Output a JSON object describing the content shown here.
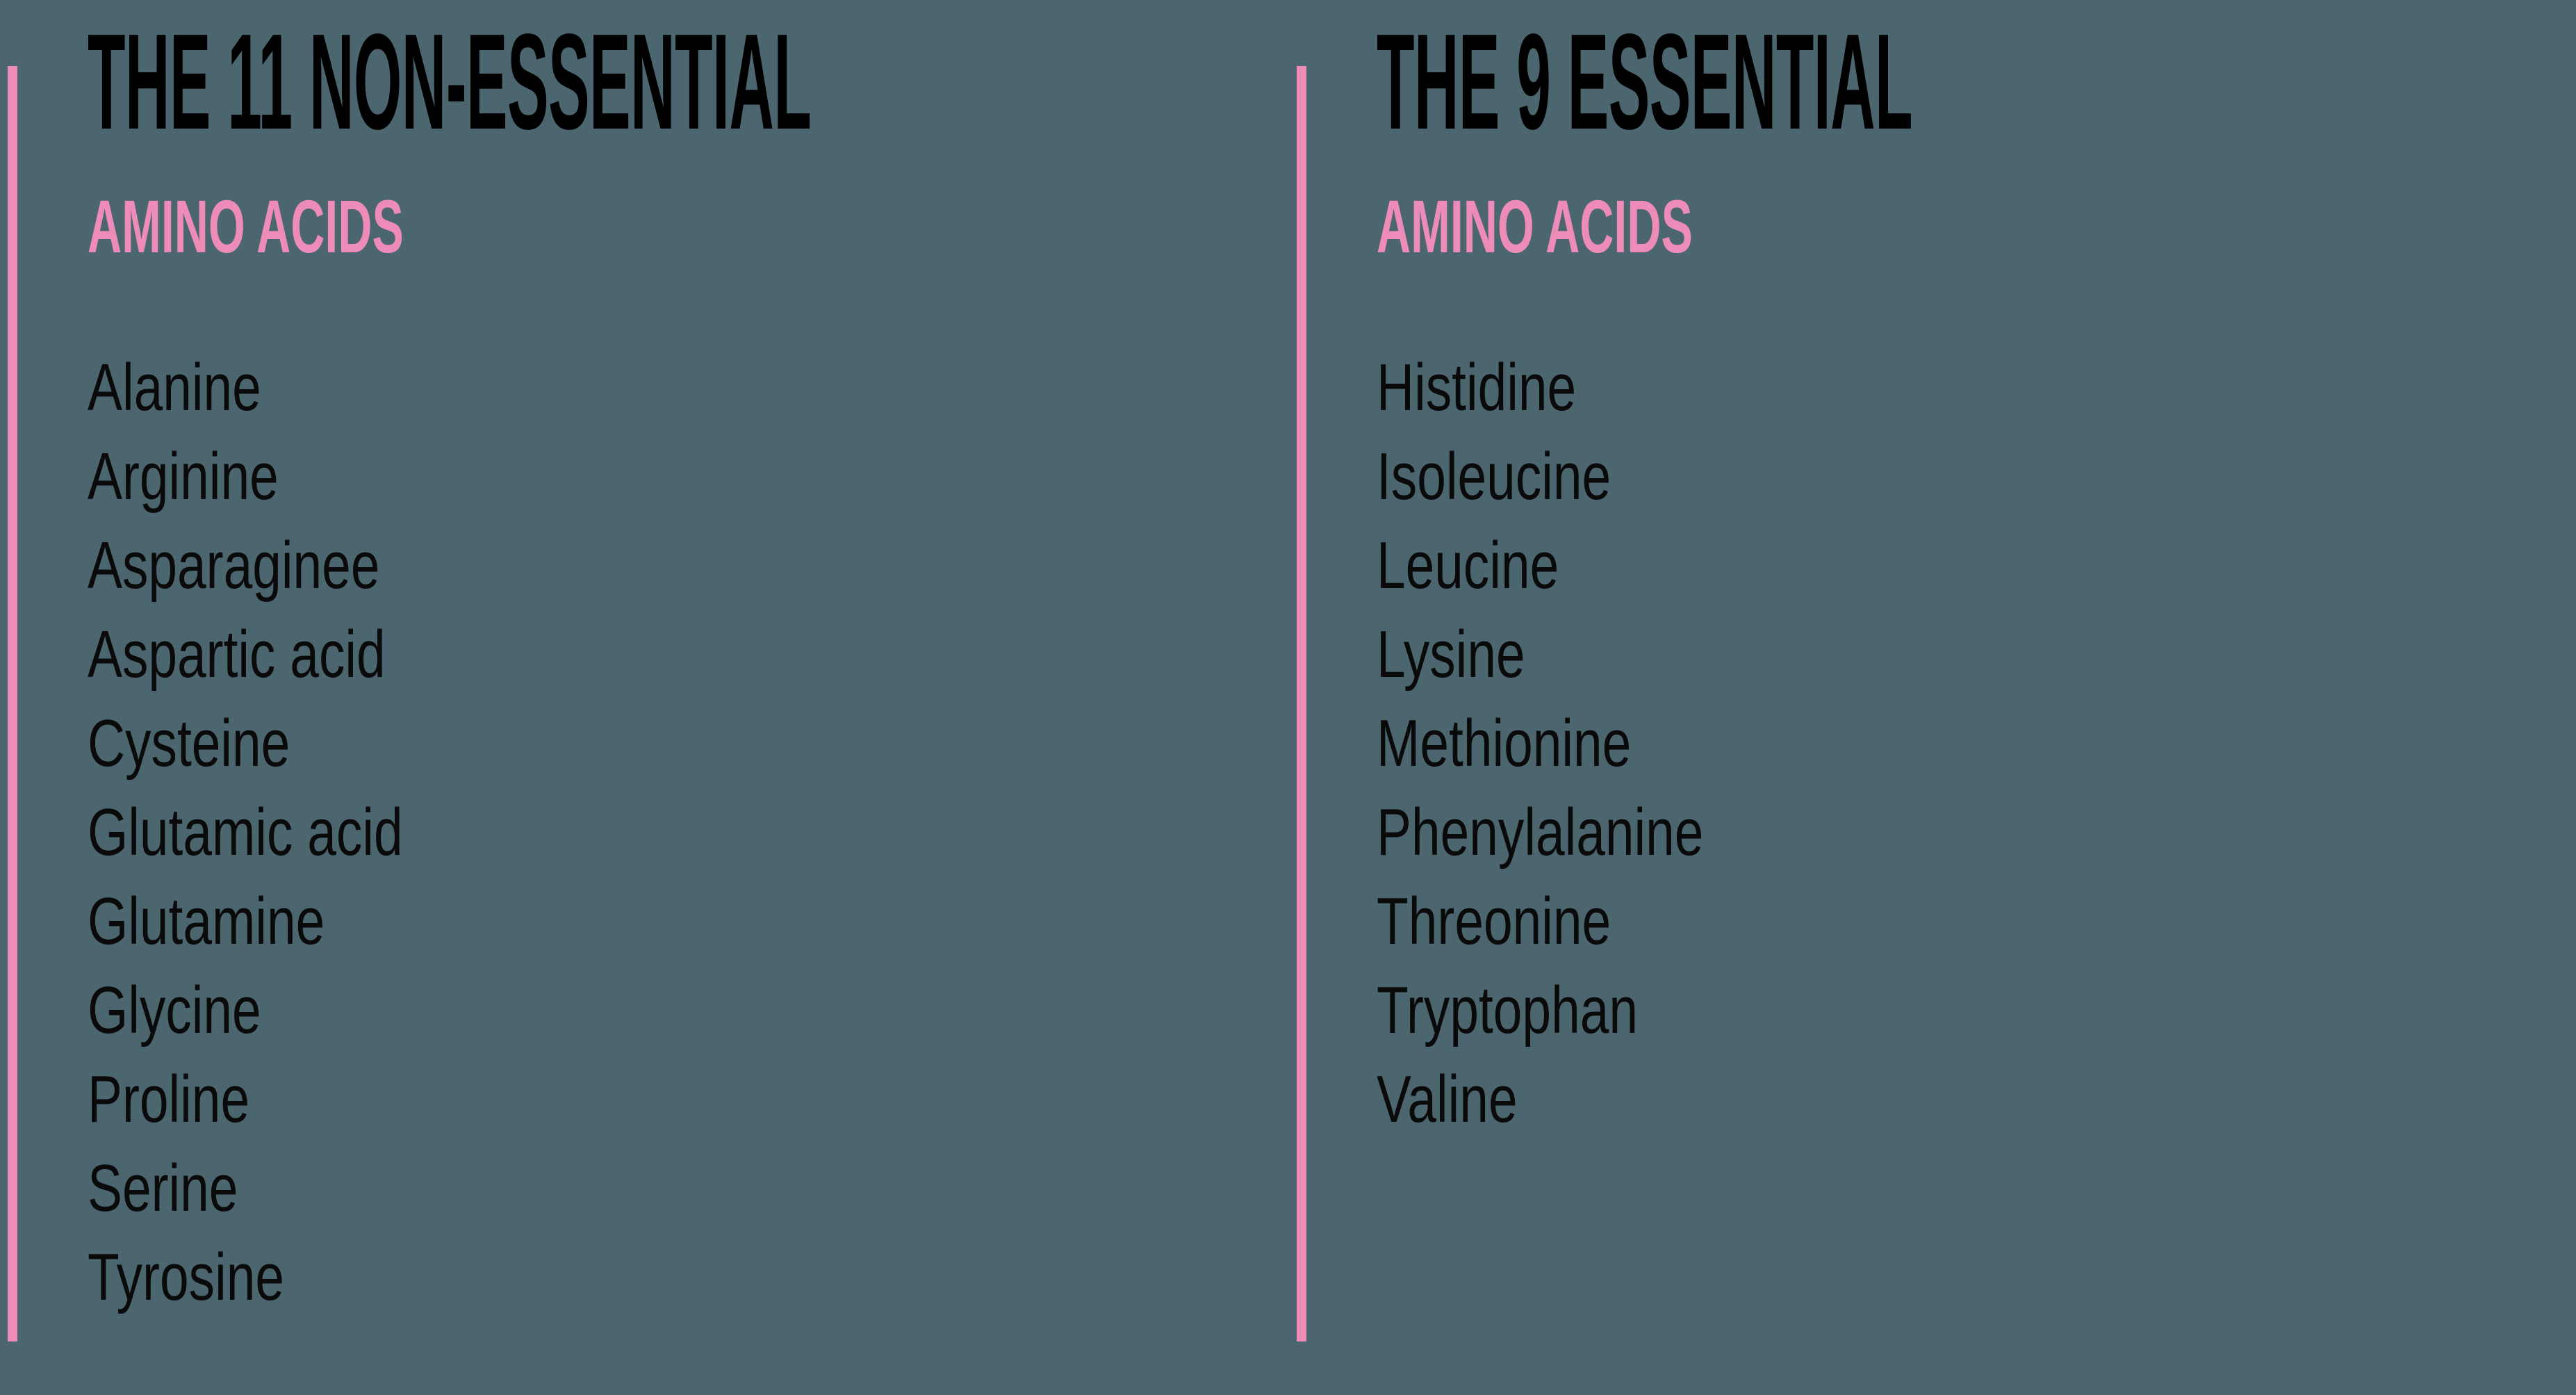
{
  "theme": {
    "background_color": "#4C6670",
    "accent_color": "#ED8CB8",
    "text_color": "#0A0A0A"
  },
  "columns": [
    {
      "id": "non-essential",
      "heading": "THE 11 NON-ESSENTIAL",
      "subheading": "AMINO ACIDS",
      "count": 11,
      "items": [
        "Alanine",
        "Arginine",
        "Asparaginee",
        "Aspartic acid",
        "Cysteine",
        "Glutamic acid",
        "Glutamine",
        "Glycine",
        "Proline",
        "Serine",
        "Tyrosine"
      ]
    },
    {
      "id": "essential",
      "heading": "THE 9 ESSENTIAL",
      "subheading": "AMINO ACIDS",
      "count": 9,
      "items": [
        "Histidine",
        "Isoleucine",
        "Leucine",
        "Lysine",
        "Methionine",
        "Phenylalanine",
        "Threonine",
        "Tryptophan",
        "Valine"
      ]
    }
  ]
}
